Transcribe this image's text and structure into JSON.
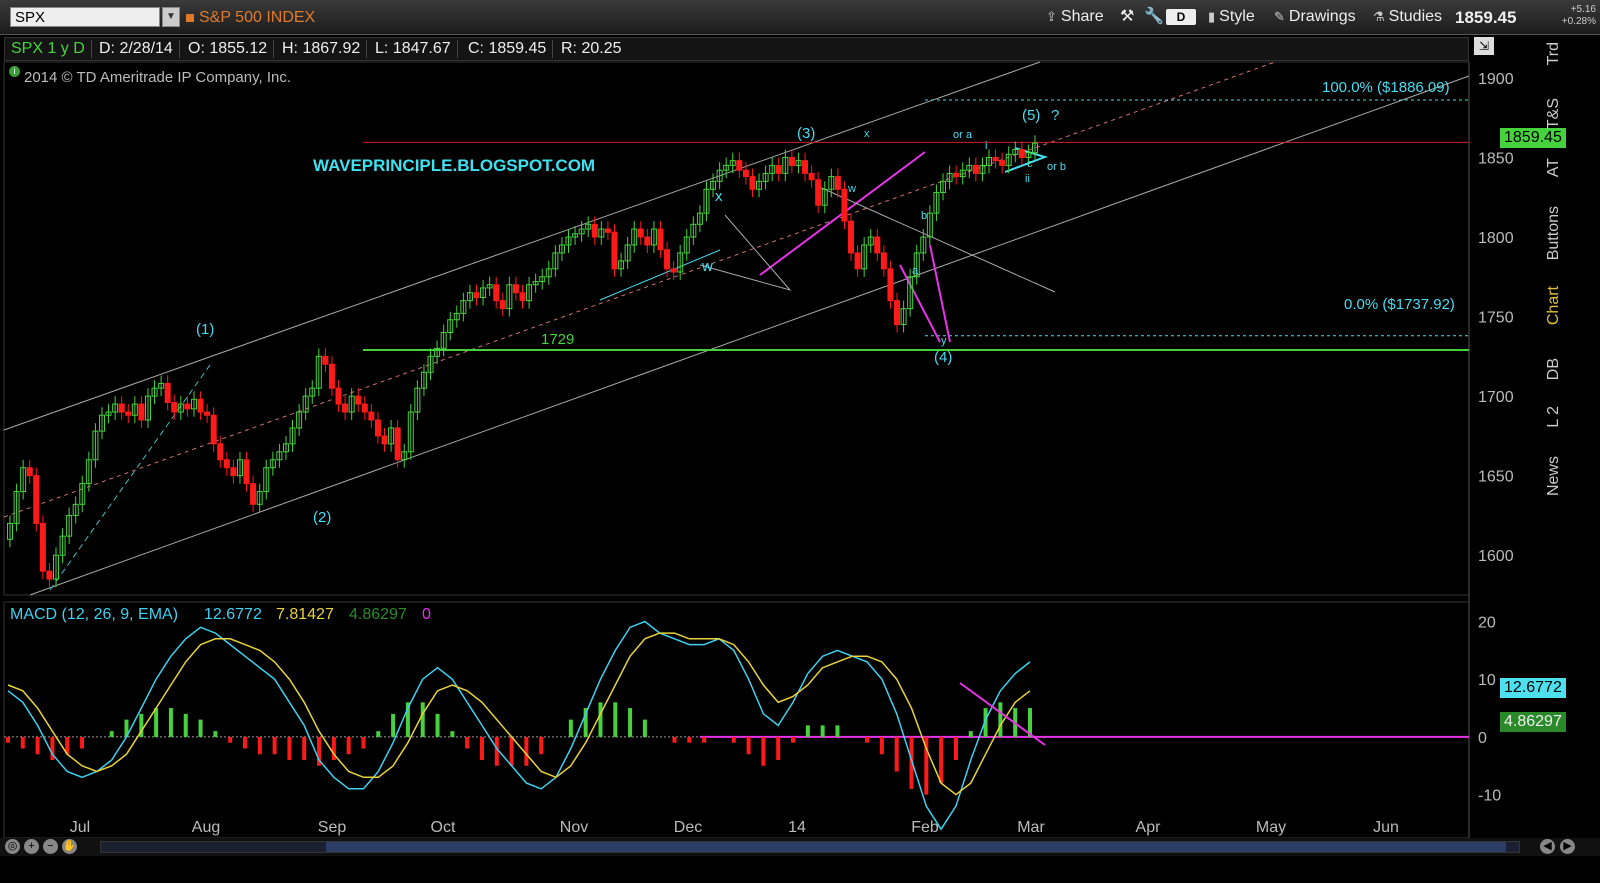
{
  "toolbar": {
    "symbol": "SPX",
    "index_name": "S&P 500 INDEX",
    "share": "Share",
    "d_button": "D",
    "style": "Style",
    "drawings": "Drawings",
    "studies": "Studies",
    "last_price": "1859.45",
    "net_change": "+5.16",
    "pct_change": "+0.28%"
  },
  "info_bar": {
    "symbol_range": "SPX 1 y D",
    "date": "D: 2/28/14",
    "open": "O: 1855.12",
    "high": "H: 1867.92",
    "low": "L: 1847.67",
    "close": "C: 1859.45",
    "range": "R: 20.25"
  },
  "copyright": "2014 © TD Ameritrade IP Company, Inc.",
  "watermark": "WAVEPRINCIPLE.BLOGSPOT.COM",
  "right_tabs": [
    "Trd",
    "T&S",
    "AT",
    "Buttons",
    "Chart",
    "DB",
    "L 2",
    "News"
  ],
  "annotations": {
    "w1": "(1)",
    "w2": "(2)",
    "w3": "(3)",
    "w4": "(4)",
    "w5": "(5)",
    "q": "?",
    "support": "1729",
    "fib_100": "100.0%  ($1886.09)",
    "fib_0": "0.0%  ($1737.92)",
    "x1": "x",
    "wa": "w",
    "x2": "x",
    "wb": "w",
    "a": "a",
    "b": "b",
    "y": "y",
    "ora": "or a",
    "orb": "or b",
    "i": "i",
    "ii": "ii",
    "c": "c"
  },
  "colors": {
    "up_candle": "#46d23c",
    "down_candle": "#ff1a1a",
    "macd_line": "#3fd0f0",
    "signal_line": "#e8d23c",
    "hist_pos": "#46d23c",
    "hist_neg": "#ff1a1a",
    "drawing_magenta": "#e832e8",
    "support_line": "#46d23c",
    "price_line": "#d02020"
  },
  "price_tag": "1859.45",
  "macd_tags": {
    "macd": "12.6772",
    "diff": "4.86297"
  },
  "chart_data": [
    {
      "type": "candlestick",
      "title": "S&P 500 INDEX",
      "x_ticks": [
        "Jul",
        "Aug",
        "Sep",
        "Oct",
        "Nov",
        "Dec",
        "14",
        "Feb",
        "Mar",
        "Apr",
        "May",
        "Jun"
      ],
      "y_ticks": [
        1600,
        1650,
        1700,
        1750,
        1800,
        1850,
        1900
      ],
      "ylim": [
        1575,
        1910
      ],
      "close_series": [
        1620,
        1640,
        1655,
        1650,
        1620,
        1590,
        1585,
        1600,
        1612,
        1625,
        1632,
        1645,
        1660,
        1678,
        1688,
        1690,
        1695,
        1690,
        1688,
        1695,
        1685,
        1700,
        1705,
        1708,
        1696,
        1690,
        1695,
        1692,
        1698,
        1690,
        1688,
        1670,
        1660,
        1655,
        1650,
        1660,
        1645,
        1632,
        1640,
        1655,
        1660,
        1665,
        1670,
        1680,
        1690,
        1700,
        1705,
        1725,
        1720,
        1705,
        1695,
        1690,
        1700,
        1695,
        1690,
        1685,
        1675,
        1670,
        1680,
        1660,
        1665,
        1690,
        1705,
        1715,
        1725,
        1730,
        1740,
        1748,
        1752,
        1760,
        1765,
        1762,
        1768,
        1770,
        1760,
        1755,
        1770,
        1765,
        1760,
        1770,
        1772,
        1775,
        1780,
        1790,
        1795,
        1800,
        1802,
        1805,
        1808,
        1800,
        1805,
        1803,
        1780,
        1785,
        1795,
        1805,
        1800,
        1795,
        1805,
        1792,
        1780,
        1778,
        1790,
        1800,
        1808,
        1815,
        1830,
        1835,
        1842,
        1845,
        1848,
        1842,
        1838,
        1830,
        1835,
        1840,
        1845,
        1840,
        1850,
        1845,
        1848,
        1840,
        1836,
        1820,
        1830,
        1838,
        1830,
        1810,
        1790,
        1780,
        1795,
        1800,
        1790,
        1780,
        1760,
        1745,
        1755,
        1775,
        1790,
        1800,
        1815,
        1828,
        1835,
        1840,
        1838,
        1842,
        1845,
        1840,
        1845,
        1850,
        1848,
        1845,
        1852,
        1855,
        1850,
        1853,
        1859
      ],
      "support_level": 1729,
      "last": 1859.45,
      "fib_100": 1886.09,
      "fib_0": 1737.92
    },
    {
      "type": "line",
      "title": "MACD (12, 26, 9, EMA)",
      "legend": [
        "MACD (12, 26, 9, EMA)",
        "12.6772",
        "7.81427",
        "4.86297",
        "0"
      ],
      "y_ticks": [
        -10,
        0,
        10,
        20
      ],
      "ylim": [
        -17,
        22
      ],
      "series": [
        {
          "name": "12.6772",
          "values": [
            8,
            6,
            2,
            -3,
            -6,
            -7,
            -6,
            -4,
            0,
            5,
            10,
            14,
            17,
            19,
            18,
            16,
            14,
            12,
            10,
            6,
            2,
            -4,
            -7,
            -9,
            -9,
            -6,
            -1,
            5,
            10,
            12,
            10,
            6,
            2,
            -2,
            -5,
            -8,
            -9,
            -7,
            -2,
            4,
            10,
            15,
            19,
            20,
            18,
            17,
            16,
            16,
            17,
            15,
            10,
            4,
            2,
            6,
            11,
            14,
            15,
            14,
            13,
            10,
            4,
            -4,
            -12,
            -16,
            -12,
            -4,
            3,
            8,
            11,
            13
          ]
        },
        {
          "name": "7.81427",
          "values": [
            9,
            8,
            5,
            1,
            -3,
            -5,
            -6,
            -5,
            -3,
            1,
            5,
            9,
            13,
            16,
            17,
            17,
            16,
            15,
            13,
            10,
            6,
            1,
            -3,
            -6,
            -7,
            -7,
            -5,
            -1,
            4,
            8,
            9,
            8,
            6,
            3,
            0,
            -3,
            -6,
            -7,
            -5,
            -1,
            4,
            9,
            14,
            17,
            18,
            18,
            17,
            17,
            17,
            16,
            13,
            9,
            6,
            7,
            9,
            12,
            13,
            14,
            14,
            13,
            10,
            5,
            -2,
            -8,
            -10,
            -8,
            -3,
            2,
            6,
            8
          ]
        }
      ],
      "histogram": [
        -1,
        -2,
        -3,
        -4,
        -3,
        -2,
        0,
        1,
        3,
        4,
        5,
        5,
        4,
        3,
        1,
        -1,
        -2,
        -3,
        -3,
        -4,
        -4,
        -5,
        -4,
        -3,
        -2,
        1,
        4,
        6,
        6,
        4,
        1,
        -2,
        -4,
        -5,
        -5,
        -5,
        -3,
        0,
        3,
        5,
        6,
        6,
        5,
        3,
        0,
        -1,
        -1,
        -1,
        0,
        -1,
        -3,
        -5,
        -4,
        -1,
        2,
        2,
        2,
        0,
        -1,
        -3,
        -6,
        -9,
        -10,
        -8,
        -4,
        1,
        5,
        6,
        5,
        5
      ]
    }
  ]
}
